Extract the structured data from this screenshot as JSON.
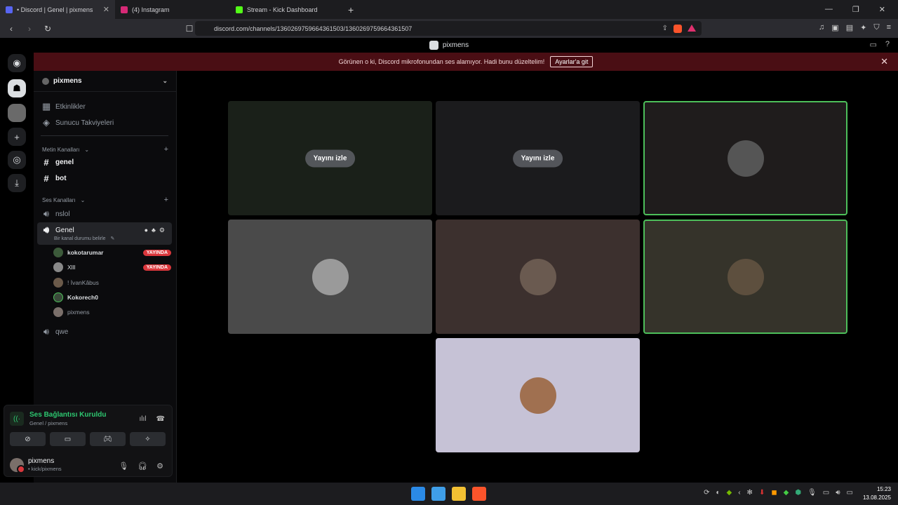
{
  "browser": {
    "tabs": [
      {
        "label": "• Discord | Genel | pixmens",
        "active": true
      },
      {
        "label": "(4) Instagram",
        "active": false
      },
      {
        "label": "Stream - Kick Dashboard",
        "active": false
      }
    ],
    "url": "discord.com/channels/1360269759664361503/1360269759664361507"
  },
  "titlebar": {
    "server_name": "pixmens"
  },
  "banner": {
    "text": "Görünen o ki, Discord mikrofonundan ses alamıyor. Hadi bunu düzeltelim!",
    "button": "Ayarlar'a git"
  },
  "sidebar": {
    "server_name": "pixmens",
    "events": "Etkinlikler",
    "boosts": "Sunucu Takviyeleri",
    "text_category": "Metin Kanalları",
    "text_channels": [
      "genel",
      "bot"
    ],
    "voice_category": "Ses Kanalları",
    "voice_channels": {
      "nslol": "nslol",
      "genel": "Genel",
      "genel_status": "Bir kanal durumu belirle",
      "qwe": "qwe"
    },
    "voice_users": [
      {
        "name": "kokotarumar",
        "live": "YAYINDA"
      },
      {
        "name": "Xlll",
        "live": "YAYINDA"
      },
      {
        "name": "! İvanKâbus",
        "live": ""
      },
      {
        "name": "Kokorech0",
        "live": ""
      },
      {
        "name": "pixmens",
        "live": ""
      }
    ]
  },
  "voice_panel": {
    "status": "Ses Bağlantısı Kuruldu",
    "channel": "Genel / pixmens"
  },
  "user_panel": {
    "name": "pixmens",
    "status": "• kick/pixmens"
  },
  "stage": {
    "watch_label": "Yayını izle"
  },
  "taskbar": {
    "time": "15:23",
    "date": "13.08.2025"
  },
  "colors": {
    "accent_green": "#2dc770",
    "live_red": "#da373c",
    "banner_bg": "#4a0e14"
  }
}
